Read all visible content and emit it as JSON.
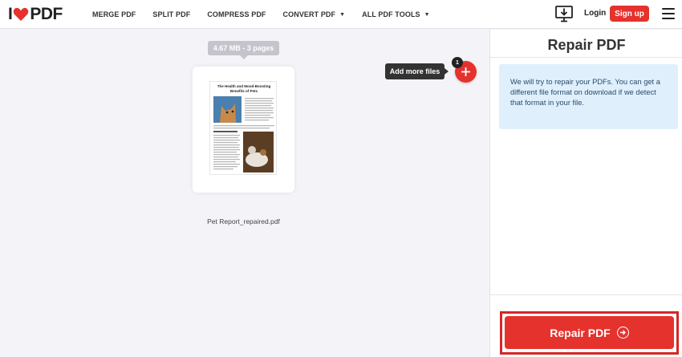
{
  "header": {
    "logo_left": "I",
    "logo_right": "PDF",
    "nav": [
      {
        "label": "MERGE PDF"
      },
      {
        "label": "SPLIT PDF"
      },
      {
        "label": "COMPRESS PDF"
      },
      {
        "label": "CONVERT PDF"
      },
      {
        "label": "ALL PDF TOOLS"
      }
    ],
    "login_label": "Login",
    "signup_label": "Sign up"
  },
  "workspace": {
    "size_badge": "4.67 MB - 3 pages",
    "file": {
      "name": "Pet Report_repaired.pdf",
      "preview_title": "The Health and Mood-Boosting Benefits of Pets"
    },
    "add_tooltip": "Add more files",
    "file_count": "1"
  },
  "sidebar": {
    "title": "Repair PDF",
    "info": "We will try to repair your PDFs. You can get a different file format on download if we detect that format in your file.",
    "repair_button": "Repair PDF"
  },
  "colors": {
    "brand_red": "#e5322d",
    "info_bg": "#dff0fc",
    "workspace_bg": "#f4f4f8"
  }
}
